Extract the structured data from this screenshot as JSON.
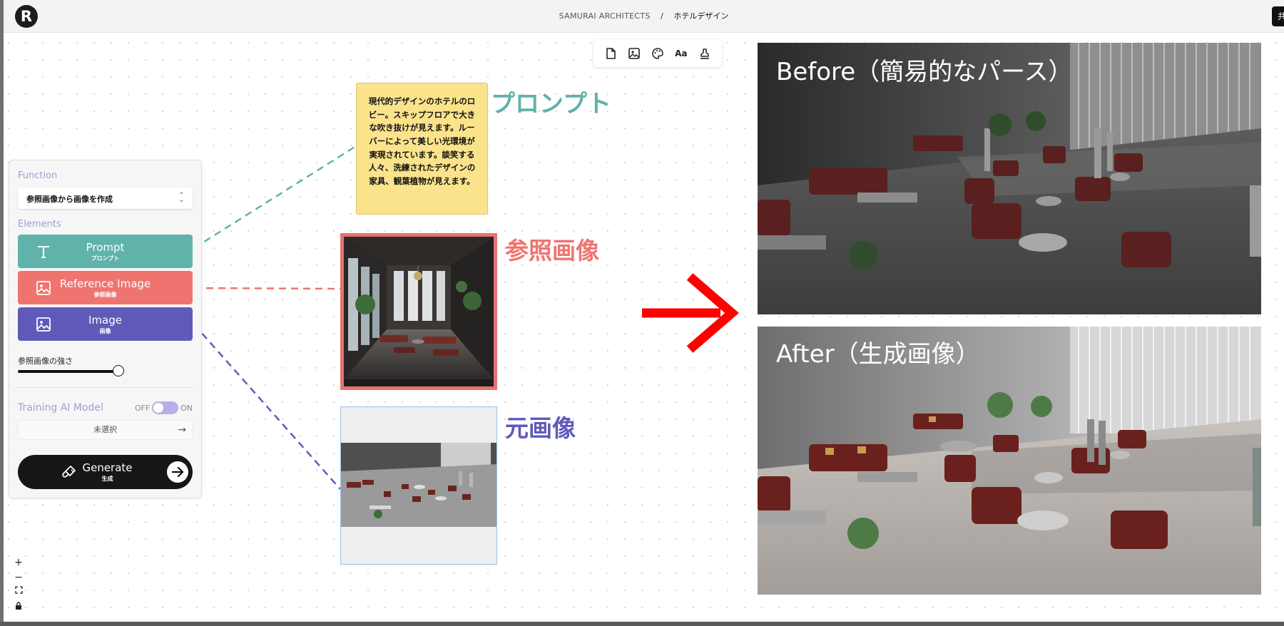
{
  "header": {
    "logo_letter": "R",
    "org": "SAMURAI ARCHITECTS",
    "separator": "/",
    "page": "ホテルデザイン",
    "right_button_label": "共"
  },
  "toolbar": {
    "tools": [
      "file-icon",
      "image-icon",
      "palette-icon",
      "text-style-icon",
      "stamp-icon"
    ],
    "text_style_glyph": "Aa"
  },
  "panel": {
    "function_label": "Function",
    "function_value": "参照画像から画像を作成",
    "elements_label": "Elements",
    "elements": [
      {
        "label": "Prompt",
        "sublabel": "プロンプト",
        "color": "#5fb3aa"
      },
      {
        "label": "Reference Image",
        "sublabel": "参照画像",
        "color": "#ef7470"
      },
      {
        "label": "Image",
        "sublabel": "画像",
        "color": "#5f5aba"
      }
    ],
    "strength_label": "参照画像の強さ",
    "strength_value": 0.85,
    "training_label": "Training AI Model",
    "toggle_off": "OFF",
    "toggle_on": "ON",
    "model_value": "未選択",
    "generate_label": "Generate",
    "generate_sublabel": "生成"
  },
  "zoom_controls": [
    "+",
    "−",
    "⛶",
    "🔒"
  ],
  "canvas": {
    "prompt_text": "現代的デザインのホテルのロビー。スキップフロアで大きな吹き抜けが見えます。ルーバーによって美しい光環境が実現されています。談笑する人々、洗練されたデザインの家具、観葉植物が見えます。",
    "prompt_caption": "プロンプト",
    "reference_caption": "参照画像",
    "original_caption": "元画像",
    "before_title": "Before（簡易的なパース）",
    "after_title": "After（生成画像）",
    "colors": {
      "prompt": "#5fb3aa",
      "reference": "#ef7470",
      "image": "#5f5aba",
      "arrow": "#ff0000"
    }
  }
}
